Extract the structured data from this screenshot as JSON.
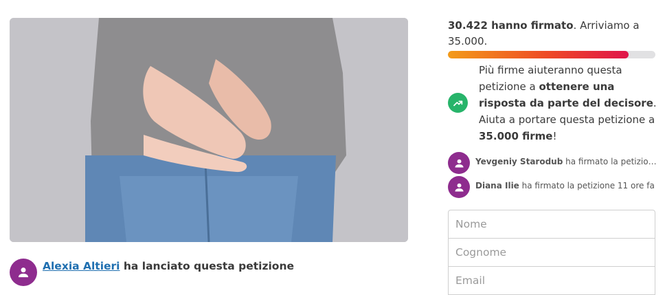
{
  "progress": {
    "signed_bold": "30.422 hanno firmato",
    "goal_text": ". Arriviamo a 35.000.",
    "fill_fraction": 0.87
  },
  "info": {
    "t1": "Più firme aiuteranno questa petizione a ",
    "b1": "ottenere una risposta da parte del decisore",
    "t2": ". Aiuta a portare questa petizione a ",
    "b2": "35.000 firme",
    "t3": "!"
  },
  "signers": [
    {
      "name": "Yevgeniy Starodub",
      "action": " ha firmato la petizione ..."
    },
    {
      "name": "Diana Ilie",
      "action": " ha firmato la petizione 11 ore fa"
    }
  ],
  "form": {
    "nome_placeholder": "Nome",
    "cognome_placeholder": "Cognome",
    "email_placeholder": "Email"
  },
  "starter": {
    "name": "Alexia Altieri",
    "action": " ha lanciato questa petizione"
  },
  "colors": {
    "avatar": "#8e2c8e",
    "trend_icon": "#27b46a",
    "link": "#1f6fb0"
  },
  "icons": {
    "avatar": "person-icon",
    "trend": "trending-up-icon"
  }
}
